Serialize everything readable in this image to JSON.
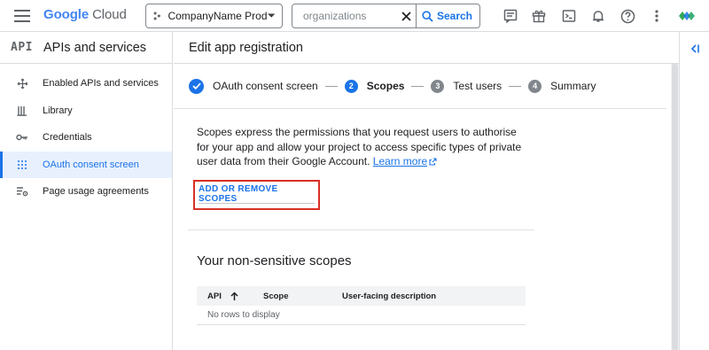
{
  "topbar": {
    "logo_google": "Google",
    "logo_cloud": "Cloud",
    "project_name": "CompanyName Prod",
    "search_placeholder": "organizations",
    "search_button": "Search"
  },
  "sidebar": {
    "badge": "API",
    "title": "APIs and services",
    "items": [
      {
        "label": "Enabled APIs and services",
        "icon": "move-icon",
        "active": false
      },
      {
        "label": "Library",
        "icon": "library-icon",
        "active": false
      },
      {
        "label": "Credentials",
        "icon": "key-icon",
        "active": false
      },
      {
        "label": "OAuth consent screen",
        "icon": "dots-grid-icon",
        "active": true
      },
      {
        "label": "Page usage agreements",
        "icon": "settings-list-icon",
        "active": false
      }
    ]
  },
  "page": {
    "title": "Edit app registration"
  },
  "stepper": {
    "steps": [
      {
        "label": "OAuth consent screen",
        "status": "done"
      },
      {
        "num": "2",
        "label": "Scopes",
        "status": "current"
      },
      {
        "num": "3",
        "label": "Test users",
        "status": "todo"
      },
      {
        "num": "4",
        "label": "Summary",
        "status": "todo"
      }
    ]
  },
  "content": {
    "description": "Scopes express the permissions that you request users to authorise for your app and allow your project to access specific types of private user data from their Google Account.",
    "learn_more": "Learn more",
    "add_scopes_button": "ADD OR REMOVE SCOPES",
    "section_title": "Your non-sensitive scopes"
  },
  "table": {
    "columns": [
      "API",
      "Scope",
      "User-facing description"
    ],
    "sort_column": "API",
    "empty_text": "No rows to display"
  },
  "colors": {
    "accent": "#1a73e8",
    "highlight": "#d93025"
  }
}
